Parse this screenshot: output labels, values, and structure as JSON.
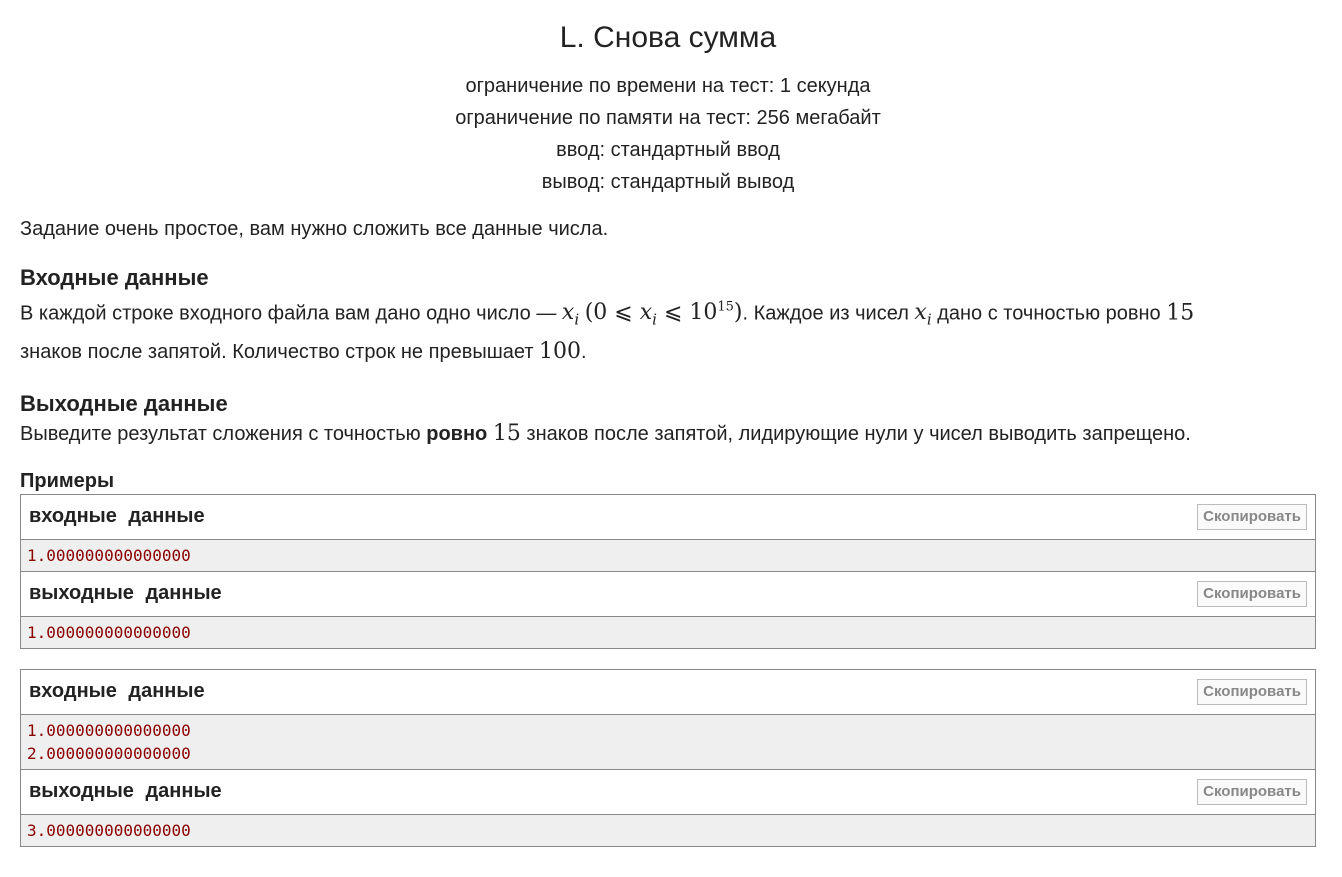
{
  "problem": {
    "title": "L. Снова сумма",
    "limits": [
      "ограничение по времени на тест: 1 секунда",
      "ограничение по памяти на тест: 256 мегабайт",
      "ввод: стандартный ввод",
      "вывод: стандартный вывод"
    ],
    "legend": "Задание очень простое, вам нужно сложить все данные числа.",
    "input": {
      "title": "Входные данные",
      "text1": "В каждой строке входного файла вам дано одно число —",
      "var": "x",
      "var_sub": "i",
      "cond_open": "(0 ⩽",
      "cond_le": "⩽ 10",
      "cond_exp": "15",
      "cond_close": ")",
      "text2": ". Каждое из чисел",
      "text3": "дано с точностью ровно",
      "num15": "15",
      "text4": "знаков после запятой. Количество строк не превышает",
      "num100": "100",
      "text5": "."
    },
    "output": {
      "title": "Выходные данные",
      "text1": "Выведите результат сложения с точностью",
      "bold": "ровно",
      "num15": "15",
      "text2": "знаков после запятой, лидирующие нули у чисел выводить запрещено."
    },
    "examples_title": "Примеры",
    "input_label": "входные данные",
    "output_label": "выходные данные",
    "copy_label": "Скопировать",
    "examples": [
      {
        "input": [
          "1.000000000000000"
        ],
        "output": [
          "1.000000000000000"
        ]
      },
      {
        "input": [
          "1.000000000000000",
          "2.000000000000000"
        ],
        "output": [
          "3.000000000000000"
        ]
      }
    ]
  }
}
